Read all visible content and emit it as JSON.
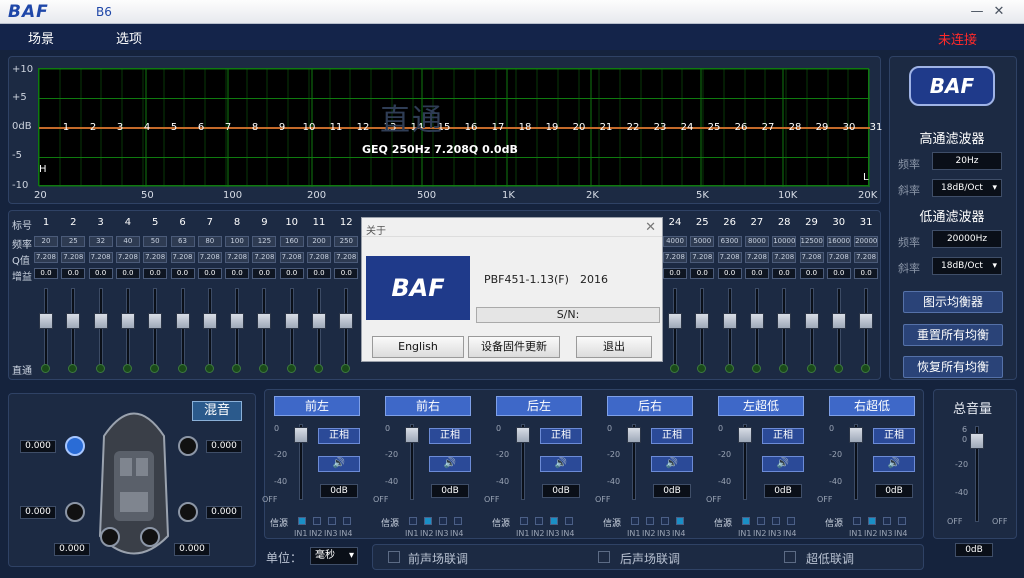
{
  "window": {
    "logo": "BAF",
    "model": "B6",
    "minimize": "—",
    "close": "✕"
  },
  "menu": {
    "items": [
      "场景",
      "选项"
    ],
    "status": "未连接"
  },
  "graph": {
    "y_labels": [
      "+10",
      "+5",
      "0dB",
      "-5",
      "-10"
    ],
    "x_labels": [
      "20",
      "50",
      "100",
      "200",
      "500",
      "1K",
      "2K",
      "5K",
      "10K",
      "20K"
    ],
    "band_points": [
      "1",
      "2",
      "3",
      "4",
      "5",
      "6",
      "7",
      "8",
      "9",
      "10",
      "11",
      "12",
      "13",
      "14",
      "15",
      "16",
      "17",
      "18",
      "19",
      "20",
      "21",
      "22",
      "23",
      "24",
      "25",
      "26",
      "27",
      "28",
      "29",
      "30",
      "31"
    ],
    "h_marker": "H",
    "l_marker": "L",
    "watermark": "直通",
    "info": "GEQ 250Hz 7.208Q 0.0dB"
  },
  "eq": {
    "row_labels": [
      "标号",
      "频率",
      "Q值",
      "增益",
      "直通"
    ],
    "bands_left": [
      {
        "n": "1",
        "f": "20",
        "q": "7.208",
        "g": "0.0"
      },
      {
        "n": "2",
        "f": "25",
        "q": "7.208",
        "g": "0.0"
      },
      {
        "n": "3",
        "f": "32",
        "q": "7.208",
        "g": "0.0"
      },
      {
        "n": "4",
        "f": "40",
        "q": "7.208",
        "g": "0.0"
      },
      {
        "n": "5",
        "f": "50",
        "q": "7.208",
        "g": "0.0"
      },
      {
        "n": "6",
        "f": "63",
        "q": "7.208",
        "g": "0.0"
      },
      {
        "n": "7",
        "f": "80",
        "q": "7.208",
        "g": "0.0"
      },
      {
        "n": "8",
        "f": "100",
        "q": "7.208",
        "g": "0.0"
      },
      {
        "n": "9",
        "f": "125",
        "q": "7.208",
        "g": "0.0"
      },
      {
        "n": "10",
        "f": "160",
        "q": "7.208",
        "g": "0.0"
      },
      {
        "n": "11",
        "f": "200",
        "q": "7.208",
        "g": "0.0"
      },
      {
        "n": "12",
        "f": "250",
        "q": "7.208",
        "g": "0.0"
      }
    ],
    "bands_right": [
      {
        "n": "24",
        "f": "4000",
        "q": "7.208",
        "g": "0.0"
      },
      {
        "n": "25",
        "f": "5000",
        "q": "7.208",
        "g": "0.0"
      },
      {
        "n": "26",
        "f": "6300",
        "q": "7.208",
        "g": "0.0"
      },
      {
        "n": "27",
        "f": "8000",
        "q": "7.208",
        "g": "0.0"
      },
      {
        "n": "28",
        "f": "10000",
        "q": "7.208",
        "g": "0.0"
      },
      {
        "n": "29",
        "f": "12500",
        "q": "7.208",
        "g": "0.0"
      },
      {
        "n": "30",
        "f": "16000",
        "q": "7.208",
        "g": "0.0"
      },
      {
        "n": "31",
        "f": "20000",
        "q": "7.208",
        "g": "0.0"
      }
    ]
  },
  "dialog": {
    "title": "关于",
    "close": "✕",
    "logo": "BAF",
    "version": "PBF451-1.13(F)",
    "year": "2016",
    "sn_label": "S/N:",
    "buttons": [
      "English",
      "设备固件更新",
      "退出"
    ]
  },
  "side": {
    "logo": "BAF",
    "hp_title": "高通滤波器",
    "hp_freq_label": "频率",
    "hp_freq": "20Hz",
    "hp_slope_label": "斜率",
    "hp_slope": "18dB/Oct",
    "lp_title": "低通滤波器",
    "lp_freq_label": "频率",
    "lp_freq": "20000Hz",
    "lp_slope_label": "斜率",
    "lp_slope": "18dB/Oct",
    "buttons": [
      "图示均衡器",
      "重置所有均衡",
      "恢复所有均衡"
    ]
  },
  "mix": {
    "button": "混音",
    "values": [
      "0.000",
      "0.000",
      "0.000",
      "0.000",
      "0.000",
      "0.000"
    ]
  },
  "channels": [
    {
      "title": "前左",
      "phase": "正相",
      "db": "0dB",
      "source_on": 0
    },
    {
      "title": "前右",
      "phase": "正相",
      "db": "0dB",
      "source_on": 1
    },
    {
      "title": "后左",
      "phase": "正相",
      "db": "0dB",
      "source_on": 2
    },
    {
      "title": "后右",
      "phase": "正相",
      "db": "0dB",
      "source_on": 3
    },
    {
      "title": "左超低",
      "phase": "正相",
      "db": "0dB",
      "source_on": 0
    },
    {
      "title": "右超低",
      "phase": "正相",
      "db": "0dB",
      "source_on": 1
    }
  ],
  "channel_common": {
    "ticks": [
      "0",
      "-20",
      "-40",
      "OFF"
    ],
    "source_label": "信源",
    "inputs": [
      "IN1",
      "IN2",
      "IN3",
      "IN4"
    ]
  },
  "master": {
    "title": "总音量",
    "ticks": [
      "6",
      "0",
      "-20",
      "-40",
      "OFF"
    ],
    "db": "0dB"
  },
  "bottom": {
    "unit_label": "单位：",
    "unit_value": "毫秒",
    "links": [
      "前声场联调",
      "后声场联调",
      "超低联调"
    ]
  },
  "colors": {
    "accent": "#3e68c8",
    "status": "#ff2a2a",
    "grid": "#0f7a0f",
    "curve": "#c46a2a"
  }
}
